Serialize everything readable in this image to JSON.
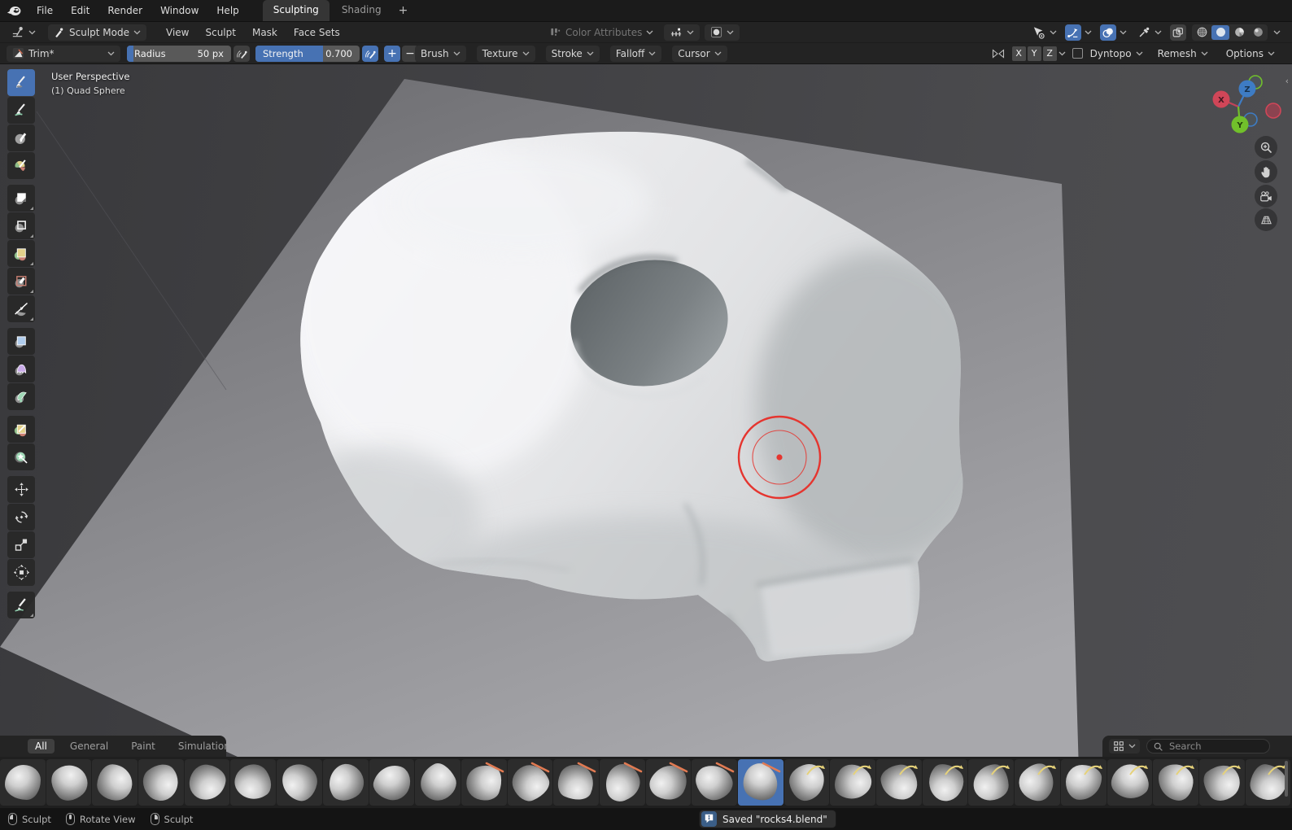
{
  "topbar": {
    "menus": [
      "File",
      "Edit",
      "Render",
      "Window",
      "Help"
    ],
    "workspaces": [
      {
        "label": "Sculpting",
        "active": true
      },
      {
        "label": "Shading",
        "active": false
      }
    ],
    "new_workspace_label": "+"
  },
  "viewport_header": {
    "mode_label": "Sculpt Mode",
    "menus": [
      "View",
      "Sculpt",
      "Mask",
      "Face Sets"
    ],
    "color_attributes_label": "Color Attributes",
    "gizmos_active": true,
    "overlays_active": true,
    "shading_mode": "solid"
  },
  "tool_header": {
    "brush_name": "Trim*",
    "radius": {
      "label": "Radius",
      "value": "50 px",
      "fill": 0.06
    },
    "strength": {
      "label": "Strength",
      "value": "0.700",
      "fill": 0.65
    },
    "add_label": "+",
    "subtract_label": "−",
    "panels": [
      "Brush",
      "Texture",
      "Stroke",
      "Falloff",
      "Cursor"
    ],
    "symmetry_axes": [
      "X",
      "Y",
      "Z"
    ],
    "dyntopo_label": "Dyntopo",
    "remesh_label": "Remesh",
    "options_label": "Options"
  },
  "toolbar": {
    "selected_index": 0,
    "tools": [
      "brush",
      "draw-sharp",
      "clay",
      "clay-strips",
      "box-mask",
      "box-hide",
      "box-face-set",
      "box-trim",
      "line-project",
      "mesh-filter",
      "cloth-filter",
      "color-filter",
      "edit-face-set",
      "mask-by-color",
      "move",
      "rotate",
      "scale",
      "transform",
      "annotate"
    ],
    "group_break_after": [
      3,
      8,
      11,
      13,
      17
    ],
    "subtool_indicator": [
      4,
      5,
      6,
      7,
      8,
      18
    ]
  },
  "viewport": {
    "view_label": "User Perspective",
    "object_label": "(1) Quad Sphere",
    "axes": [
      "X",
      "Y",
      "Z"
    ]
  },
  "asset_shelf": {
    "tabs": [
      {
        "label": "All",
        "active": true
      },
      {
        "label": "General",
        "active": false
      },
      {
        "label": "Paint",
        "active": false
      },
      {
        "label": "Simulation",
        "active": false
      }
    ],
    "search_placeholder": "Search",
    "selected_brush_index": 16,
    "brushes": [
      {
        "accent": "plain"
      },
      {
        "accent": "plain"
      },
      {
        "accent": "plain"
      },
      {
        "accent": "plain"
      },
      {
        "accent": "plain"
      },
      {
        "accent": "plain"
      },
      {
        "accent": "plain"
      },
      {
        "accent": "plain"
      },
      {
        "accent": "plain"
      },
      {
        "accent": "plain"
      },
      {
        "accent": "orange"
      },
      {
        "accent": "orange"
      },
      {
        "accent": "orange"
      },
      {
        "accent": "orange"
      },
      {
        "accent": "orange"
      },
      {
        "accent": "orange"
      },
      {
        "accent": "orange"
      },
      {
        "accent": "yellow"
      },
      {
        "accent": "yellow"
      },
      {
        "accent": "yellow"
      },
      {
        "accent": "yellow"
      },
      {
        "accent": "yellow"
      },
      {
        "accent": "yellow"
      },
      {
        "accent": "yellow"
      },
      {
        "accent": "yellow"
      },
      {
        "accent": "yellow"
      },
      {
        "accent": "yellow"
      },
      {
        "accent": "yellow"
      }
    ]
  },
  "status_bar": {
    "hints": [
      {
        "mouse": "left",
        "label": "Sculpt"
      },
      {
        "mouse": "middle",
        "label": "Rotate View"
      },
      {
        "mouse": "right",
        "label": "Sculpt"
      }
    ],
    "notification_text": "Saved \"rocks4.blend\""
  },
  "colors": {
    "accent_blue": "#4772b3",
    "cursor_red": "#e5352f",
    "axis_x": "#d04658",
    "axis_y": "#71c02b",
    "axis_z": "#3e7cc4",
    "brush_accent_orange": "#e07a52",
    "brush_accent_yellow": "#e6d27a"
  }
}
